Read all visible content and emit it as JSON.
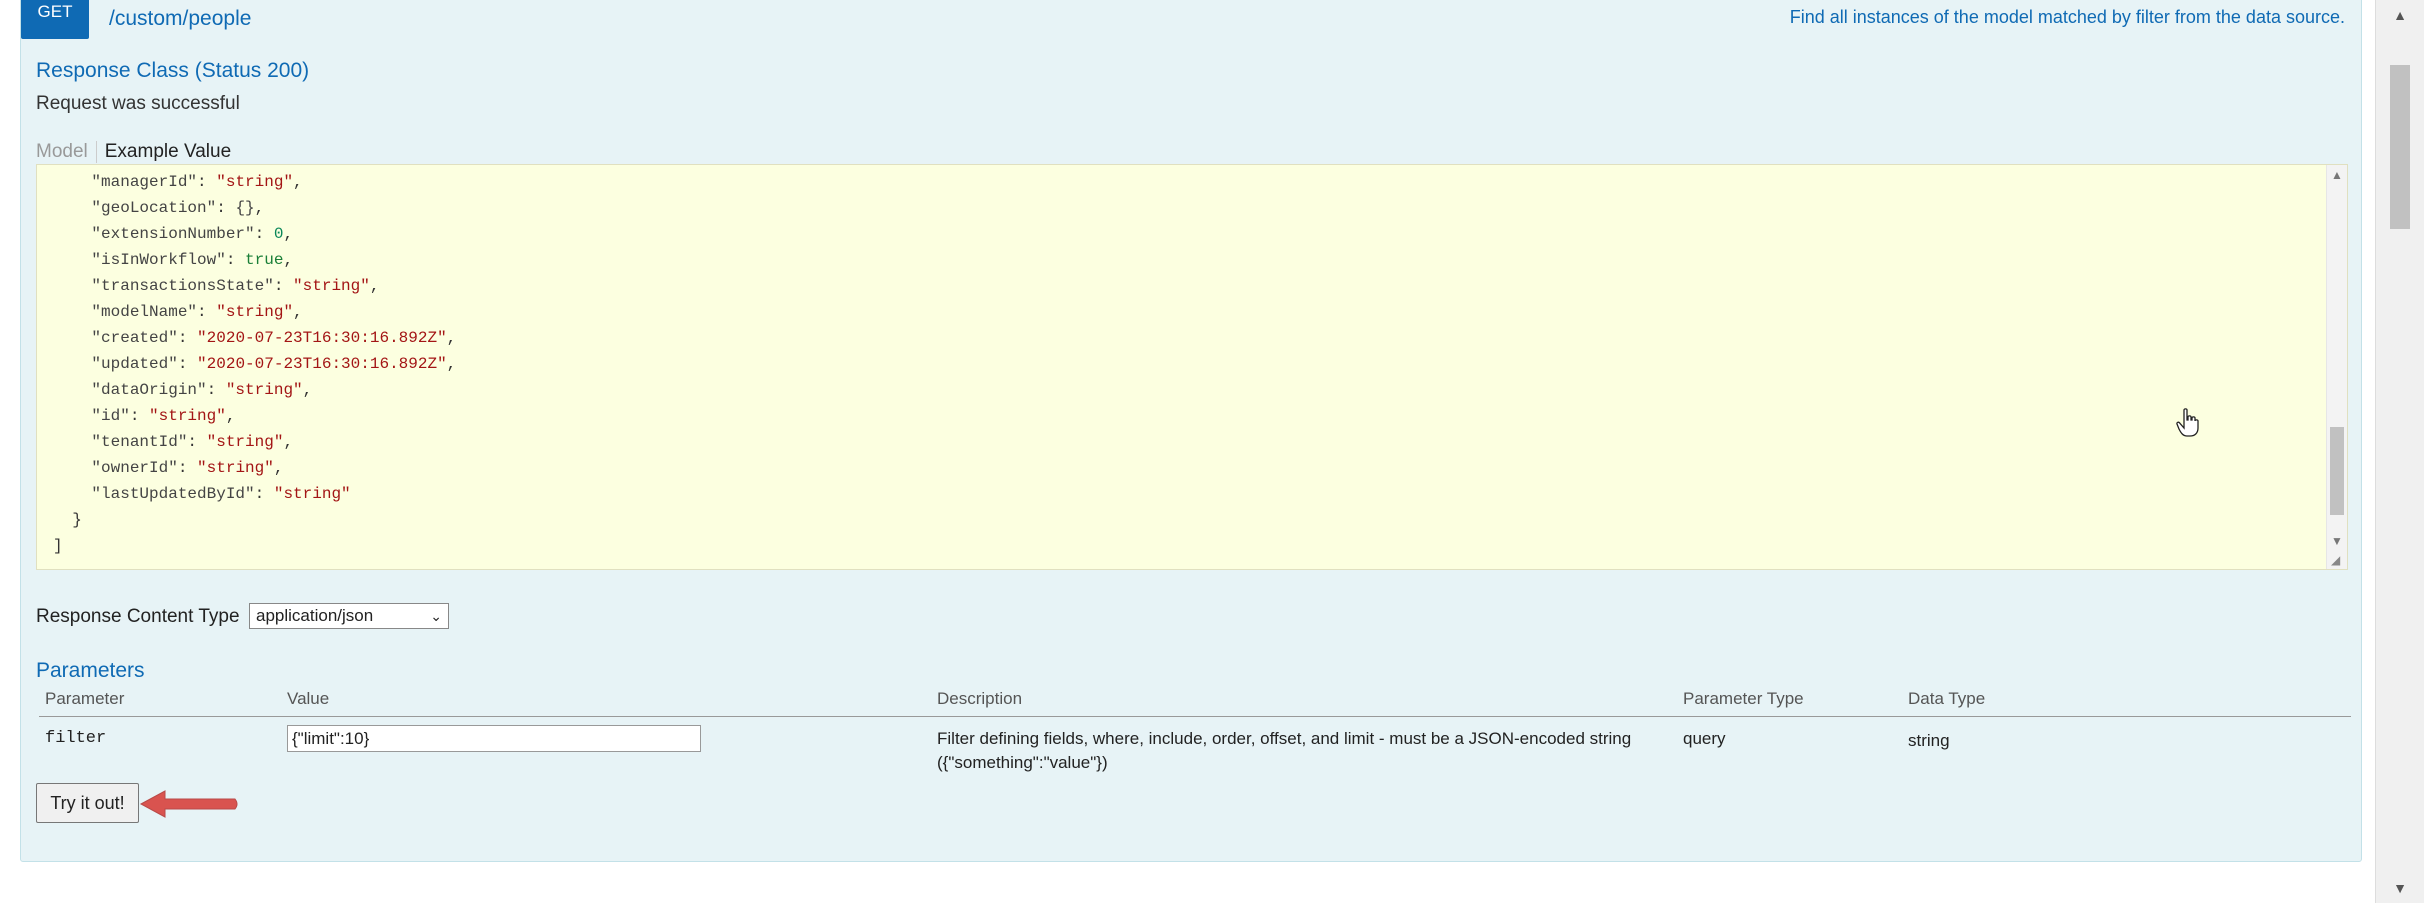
{
  "operation": {
    "method": "GET",
    "path": "/custom/people",
    "summary": "Find all instances of the model matched by filter from the data source."
  },
  "response_class": {
    "title": "Response Class (Status 200)",
    "message": "Request was successful",
    "tabs": [
      "Model",
      "Example Value"
    ]
  },
  "example_json_lines": [
    {
      "key": "\"managerId\"",
      "value": "\"string\"",
      "kind": "s",
      "comma": true
    },
    {
      "key": "\"geoLocation\"",
      "value": "{}",
      "kind": "k",
      "comma": true
    },
    {
      "key": "\"extensionNumber\"",
      "value": "0",
      "kind": "n",
      "comma": true
    },
    {
      "key": "\"isInWorkflow\"",
      "value": "true",
      "kind": "b",
      "comma": true
    },
    {
      "key": "\"transactionsState\"",
      "value": "\"string\"",
      "kind": "s",
      "comma": true
    },
    {
      "key": "\"modelName\"",
      "value": "\"string\"",
      "kind": "s",
      "comma": true
    },
    {
      "key": "\"created\"",
      "value": "\"2020-07-23T16:30:16.892Z\"",
      "kind": "s",
      "comma": true
    },
    {
      "key": "\"updated\"",
      "value": "\"2020-07-23T16:30:16.892Z\"",
      "kind": "s",
      "comma": true
    },
    {
      "key": "\"dataOrigin\"",
      "value": "\"string\"",
      "kind": "s",
      "comma": true
    },
    {
      "key": "\"id\"",
      "value": "\"string\"",
      "kind": "s",
      "comma": true
    },
    {
      "key": "\"tenantId\"",
      "value": "\"string\"",
      "kind": "s",
      "comma": true
    },
    {
      "key": "\"ownerId\"",
      "value": "\"string\"",
      "kind": "s",
      "comma": true
    },
    {
      "key": "\"lastUpdatedById\"",
      "value": "\"string\"",
      "kind": "s",
      "comma": false
    }
  ],
  "example_json_close": [
    "}",
    "]"
  ],
  "response_content_type": {
    "label": "Response Content Type",
    "selected": "application/json"
  },
  "parameters": {
    "title": "Parameters",
    "headers": [
      "Parameter",
      "Value",
      "Description",
      "Parameter Type",
      "Data Type"
    ],
    "rows": [
      {
        "name": "filter",
        "value": "{\"limit\":10}",
        "description_line1": "Filter defining fields, where, include, order, offset, and limit - must be a JSON-encoded string",
        "description_line2": "({\"something\":\"value\"})",
        "param_type": "query",
        "data_type": "string"
      }
    ]
  },
  "try_button_label": "Try it out!",
  "icons": {
    "cursor": "hand-pointer-icon",
    "callout": "red-arrow-icon",
    "callout_color": "#d9534f"
  }
}
